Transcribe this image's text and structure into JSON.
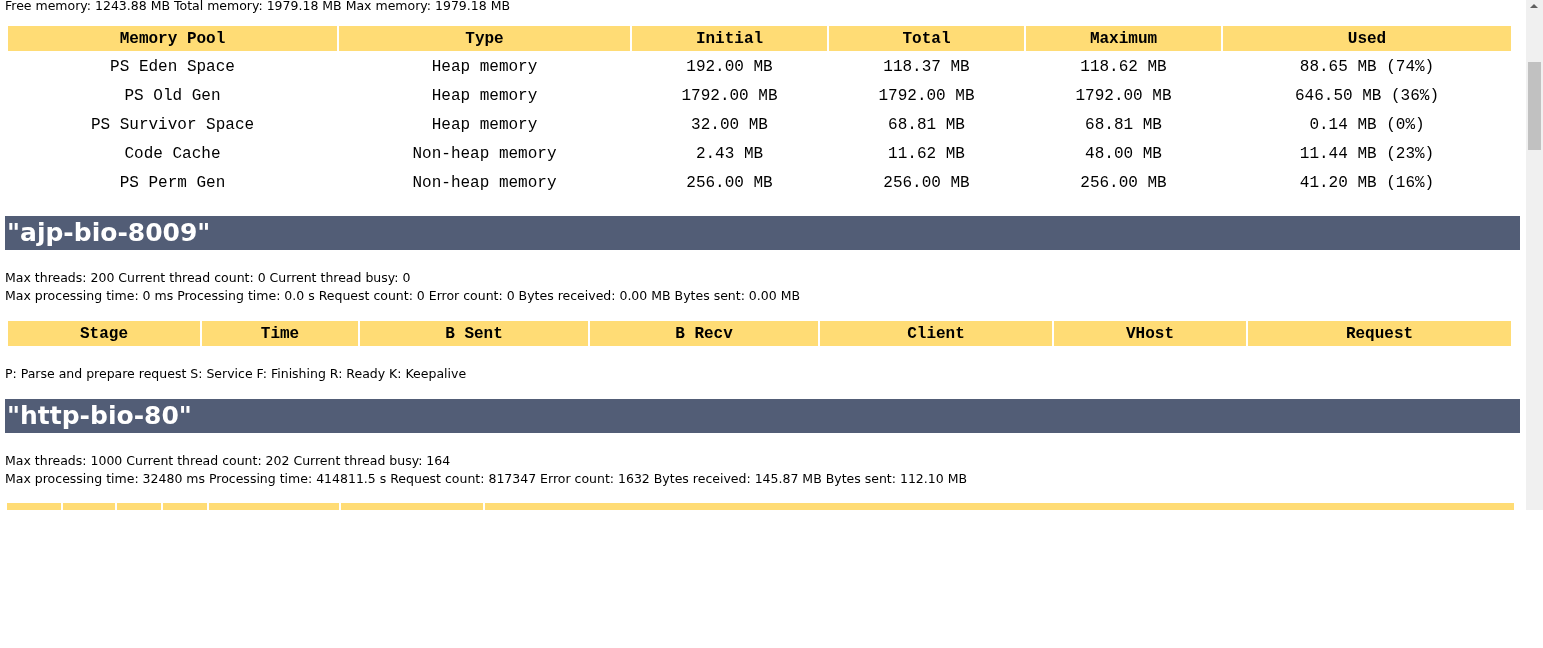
{
  "memory_summary": "Free memory: 1243.88 MB Total memory: 1979.18 MB Max memory: 1979.18 MB",
  "memory_table": {
    "columns": [
      "Memory Pool",
      "Type",
      "Initial",
      "Total",
      "Maximum",
      "Used"
    ],
    "rows": [
      [
        "PS Eden Space",
        "Heap memory",
        "192.00 MB",
        "118.37 MB",
        "118.62 MB",
        "88.65 MB (74%)"
      ],
      [
        "PS Old Gen",
        "Heap memory",
        "1792.00 MB",
        "1792.00 MB",
        "1792.00 MB",
        "646.50 MB (36%)"
      ],
      [
        "PS Survivor Space",
        "Heap memory",
        "32.00 MB",
        "68.81 MB",
        "68.81 MB",
        "0.14 MB (0%)"
      ],
      [
        "Code Cache",
        "Non-heap memory",
        "2.43 MB",
        "11.62 MB",
        "48.00 MB",
        "11.44 MB (23%)"
      ],
      [
        "PS Perm Gen",
        "Non-heap memory",
        "256.00 MB",
        "256.00 MB",
        "256.00 MB",
        "41.20 MB (16%)"
      ]
    ]
  },
  "connectors": [
    {
      "title": "\"ajp-bio-8009\"",
      "thread_info": "Max threads: 200 Current thread count: 0 Current thread busy: 0",
      "request_info": "Max processing time: 0 ms Processing time: 0.0 s Request count: 0 Error count: 0 Bytes received: 0.00 MB Bytes sent: 0.00 MB",
      "columns": [
        "Stage",
        "Time",
        "B Sent",
        "B Recv",
        "Client",
        "VHost",
        "Request"
      ],
      "legend": "P: Parse and prepare request S: Service F: Finishing R: Ready K: Keepalive"
    },
    {
      "title": "\"http-bio-80\"",
      "thread_info": "Max threads: 1000 Current thread count: 202 Current thread busy: 164",
      "request_info": "Max processing time: 32480 ms Processing time: 414811.5 s Request count: 817347 Error count: 1632 Bytes received: 145.87 MB Bytes sent: 112.10 MB"
    }
  ]
}
